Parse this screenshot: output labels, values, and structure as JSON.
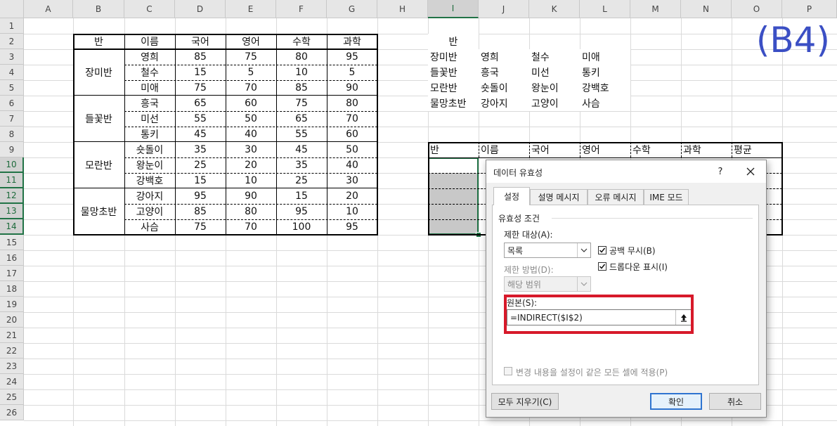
{
  "columns": [
    "A",
    "B",
    "C",
    "D",
    "E",
    "F",
    "G",
    "H",
    "I",
    "J",
    "K",
    "L",
    "M",
    "N",
    "O",
    "P"
  ],
  "rows": [
    "1",
    "2",
    "3",
    "4",
    "5",
    "6",
    "7",
    "8",
    "9",
    "10",
    "11",
    "12",
    "13",
    "14",
    "15",
    "16",
    "17",
    "18",
    "19",
    "20",
    "21",
    "22",
    "23",
    "24",
    "25",
    "26"
  ],
  "annotation": "(B4)",
  "left_table": {
    "headers": [
      "반",
      "이름",
      "국어",
      "영어",
      "수학",
      "과학"
    ],
    "groups": [
      "장미반",
      "들꽃반",
      "모란반",
      "물망초반"
    ],
    "students": [
      {
        "name": "영희",
        "kor": "85",
        "eng": "75",
        "math": "80",
        "sci": "95"
      },
      {
        "name": "철수",
        "kor": "15",
        "eng": "5",
        "math": "10",
        "sci": "5"
      },
      {
        "name": "미애",
        "kor": "75",
        "eng": "70",
        "math": "85",
        "sci": "90"
      },
      {
        "name": "흥국",
        "kor": "65",
        "eng": "60",
        "math": "75",
        "sci": "80"
      },
      {
        "name": "미선",
        "kor": "55",
        "eng": "50",
        "math": "65",
        "sci": "70"
      },
      {
        "name": "통키",
        "kor": "45",
        "eng": "40",
        "math": "55",
        "sci": "60"
      },
      {
        "name": "숏돌이",
        "kor": "35",
        "eng": "30",
        "math": "45",
        "sci": "50"
      },
      {
        "name": "왕눈이",
        "kor": "25",
        "eng": "20",
        "math": "35",
        "sci": "40"
      },
      {
        "name": "강백호",
        "kor": "15",
        "eng": "10",
        "math": "25",
        "sci": "30"
      },
      {
        "name": "강아지",
        "kor": "95",
        "eng": "90",
        "math": "15",
        "sci": "20"
      },
      {
        "name": "고양이",
        "kor": "85",
        "eng": "80",
        "math": "95",
        "sci": "10"
      },
      {
        "name": "사슴",
        "kor": "75",
        "eng": "70",
        "math": "100",
        "sci": "95"
      }
    ]
  },
  "lookup_table": {
    "header": "반",
    "rows": [
      [
        "장미반",
        "영희",
        "철수",
        "미애"
      ],
      [
        "들꽃반",
        "흥국",
        "미선",
        "통키"
      ],
      [
        "모란반",
        "숏돌이",
        "왕눈이",
        "강백호"
      ],
      [
        "물망초반",
        "강아지",
        "고양이",
        "사슴"
      ]
    ]
  },
  "result_headers": [
    "반",
    "이름",
    "국어",
    "영어",
    "수학",
    "과학",
    "평균"
  ],
  "dialog": {
    "title": "데이터 유효성",
    "help": "?",
    "tabs": [
      "설정",
      "설명 메시지",
      "오류 메시지",
      "IME 모드"
    ],
    "group_label": "유효성 조건",
    "allow_label": "제한 대상(A):",
    "allow_value": "목록",
    "ignore_blank": "공백 무시(B)",
    "dropdown": "드롭다운 표시(I)",
    "data_label": "제한 방법(D):",
    "data_value": "해당 범위",
    "source_label": "원본(S):",
    "source_value": "=INDIRECT($I$2)",
    "apply_all": "변경 내용을 설정이 같은 모든 셀에 적용(P)",
    "clear_all": "모두 지우기(C)",
    "ok": "확인",
    "cancel": "취소"
  }
}
